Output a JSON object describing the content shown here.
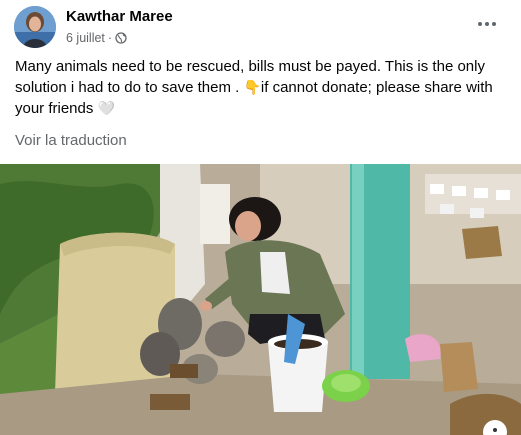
{
  "post": {
    "author": "Kawthar Maree",
    "date": "6 juillet",
    "date_separator": "·",
    "privacy_icon": "globe-icon",
    "text_part1": "Many animals need to be rescued, bills must be payed. This is the only solution i had to do to save them . ",
    "pointing_emoji": "👇",
    "text_part2": "if cannot donate; please share with your friends ",
    "heart_emoji": "🤍",
    "translate_label": "Voir la traduction",
    "more_icon": "more-options-icon"
  }
}
